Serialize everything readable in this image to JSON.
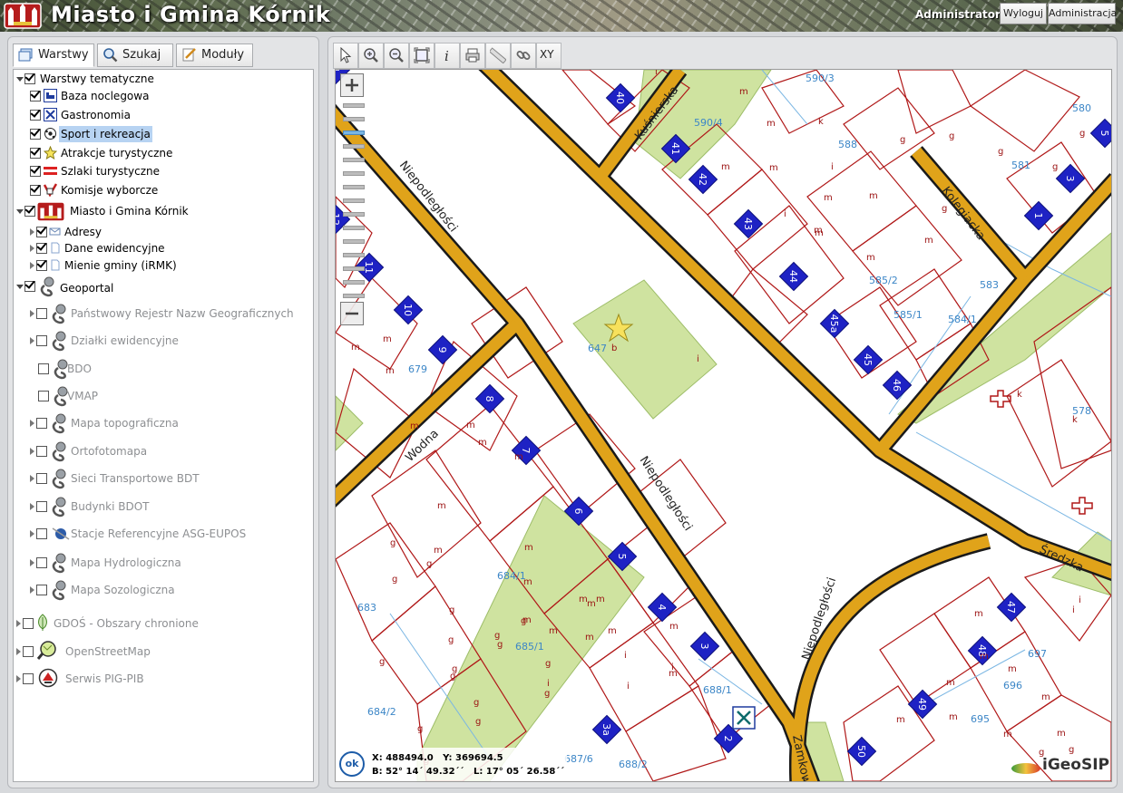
{
  "header": {
    "title": "Miasto i Gmina Kórnik",
    "user": "Administrator",
    "logout_label": "Wyloguj",
    "admin_label": "Administracja"
  },
  "tabs": [
    {
      "label": "Warstwy",
      "icon": "layers-icon",
      "active": true
    },
    {
      "label": "Szukaj",
      "icon": "search-icon"
    },
    {
      "label": "Moduły",
      "icon": "notepad-icon"
    }
  ],
  "layers": {
    "thematic": {
      "label": "Warstwy tematyczne",
      "items": [
        {
          "label": "Baza noclegowa",
          "icon": "bed-icon",
          "checked": true
        },
        {
          "label": "Gastronomia",
          "icon": "cutlery-icon",
          "checked": true
        },
        {
          "label": "Sport i rekreacja",
          "icon": "ball-icon",
          "checked": true,
          "selected": true
        },
        {
          "label": "Atrakcje turystyczne",
          "icon": "star-icon",
          "checked": true
        },
        {
          "label": "Szlaki turystyczne",
          "icon": "trail-icon",
          "checked": true
        },
        {
          "label": "Komisje wyborcze",
          "icon": "ballot-icon",
          "checked": true
        }
      ]
    },
    "city": {
      "label": "Miasto i Gmina Kórnik",
      "items": [
        {
          "label": "Adresy",
          "icon": "envelope-icon",
          "checked": true
        },
        {
          "label": "Dane ewidencyjne",
          "icon": "page-icon",
          "checked": true
        },
        {
          "label": "Mienie gminy (iRMK)",
          "icon": "page-icon",
          "checked": true
        }
      ]
    },
    "geoportal": {
      "label": "Geoportal",
      "items": [
        {
          "label": "Państwowy Rejestr Nazw Geograficznych",
          "checked": false,
          "expandable": true
        },
        {
          "label": "Działki ewidencyjne",
          "checked": false,
          "expandable": true
        },
        {
          "label": "BDO",
          "checked": false,
          "expandable": false
        },
        {
          "label": "VMAP",
          "checked": false,
          "expandable": false
        },
        {
          "label": "Mapa topograficzna",
          "checked": false,
          "expandable": true
        },
        {
          "label": "Ortofotomapa",
          "checked": false,
          "expandable": true
        },
        {
          "label": "Sieci Transportowe BDT",
          "checked": false,
          "expandable": true
        },
        {
          "label": "Budynki BDOT",
          "checked": false,
          "expandable": true
        },
        {
          "label": "Stacje Referencyjne ASG-EUPOS",
          "checked": false,
          "expandable": true
        },
        {
          "label": "Mapa Hydrologiczna",
          "checked": false,
          "expandable": true
        },
        {
          "label": "Mapa Sozologiczna",
          "checked": false,
          "expandable": true
        }
      ]
    },
    "other": [
      {
        "label": "GDOŚ - Obszary chronione",
        "icon": "leaf-icon",
        "checked": false
      },
      {
        "label": "OpenStreetMap",
        "icon": "magnifier-map-icon",
        "checked": false
      },
      {
        "label": "Serwis PIG-PIB",
        "icon": "pig-logo-icon",
        "checked": false
      }
    ]
  },
  "toolbar": {
    "tools": [
      "select-arrow-icon",
      "zoom-in-icon",
      "zoom-out-icon",
      "zoom-extent-icon",
      "info-icon",
      "print-icon",
      "measure-icon",
      "link-icon",
      "xy-icon"
    ],
    "xy_label": "XY"
  },
  "map": {
    "streets": [
      "Niepodległości",
      "Niepodległości",
      "Niepodległości",
      "Kuśnierska",
      "Kolegiacka",
      "Wodna",
      "Średzka",
      "Zamkowa"
    ],
    "building_numbers": [
      "40",
      "41",
      "42",
      "43",
      "44",
      "45a",
      "45",
      "46",
      "1",
      "3",
      "5",
      "11",
      "10",
      "9",
      "8",
      "7",
      "6",
      "5",
      "4",
      "3",
      "3a",
      "2",
      "50",
      "49",
      "48",
      "47",
      "12",
      "1"
    ],
    "parcel_numbers": [
      "590/3",
      "590/4",
      "580",
      "588",
      "581",
      "585/2",
      "585/1",
      "584/1",
      "583",
      "578",
      "647",
      "679",
      "684/1",
      "683",
      "685/1",
      "684/2",
      "688/1",
      "688/2",
      "687/6",
      "697",
      "696",
      "695"
    ],
    "parcel_letters": {
      "building": "m",
      "garden": "g",
      "industrial": "i",
      "church": "k",
      "field": "b"
    },
    "coords": {
      "x_label": "X:",
      "x": "488494.0",
      "y_label": "Y:",
      "y": "369694.5",
      "b_label": "B:",
      "b": "52° 14´ 49.32´´",
      "l_label": "L:",
      "l": "17° 05´ 26.58´´"
    },
    "ok_label": "ok",
    "brand": "iGeoSIP",
    "zoom_level_index": 2
  }
}
